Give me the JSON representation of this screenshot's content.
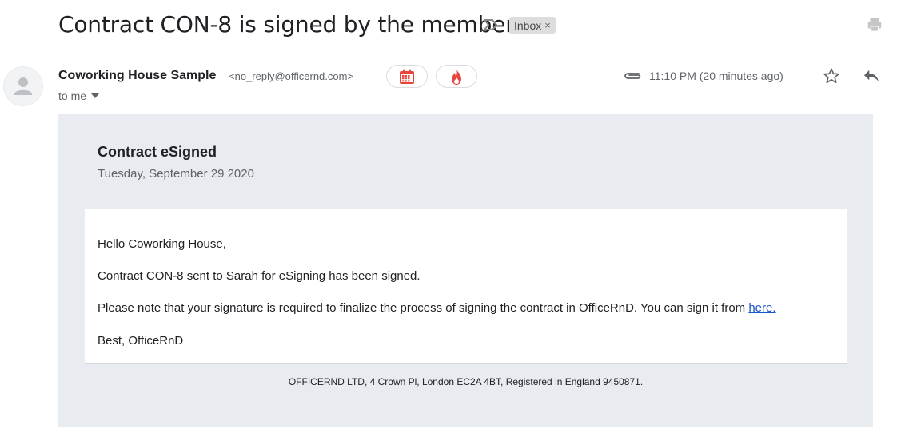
{
  "email": {
    "subject": "Contract CON-8 is signed by the member",
    "label": "Inbox",
    "label_remove": "×",
    "sender_name": "Coworking House Sample",
    "sender_email": "<no_reply@officernd.com>",
    "recipient": "to me",
    "time": "11:10 PM (20 minutes ago)"
  },
  "content": {
    "title": "Contract eSigned",
    "date": "Tuesday, September 29 2020",
    "greeting": "Hello Coworking House,",
    "line1": "Contract CON-8 sent to Sarah for eSigning has been signed.",
    "line2": "Please note that your signature is required to finalize the process of signing the contract in OfficeRnD. You can sign it from ",
    "link_text": "here.",
    "signoff": "Best, OfficeRnD",
    "footer": "OFFICERND LTD, 4 Crown Pl, London EC2A 4BT, Registered in England 9450871."
  },
  "icons": {
    "important": "important-marker-icon",
    "print": "print-icon",
    "avatar": "avatar-placeholder-icon",
    "calendar": "calendar-icon",
    "fire": "fire-icon",
    "attachment": "paperclip-icon",
    "star": "star-icon",
    "reply": "reply-icon",
    "dropdown": "chevron-down-icon"
  },
  "colors": {
    "accent_red": "#e8453c",
    "link": "#1a56c8",
    "body_bg": "#e8ebef"
  }
}
